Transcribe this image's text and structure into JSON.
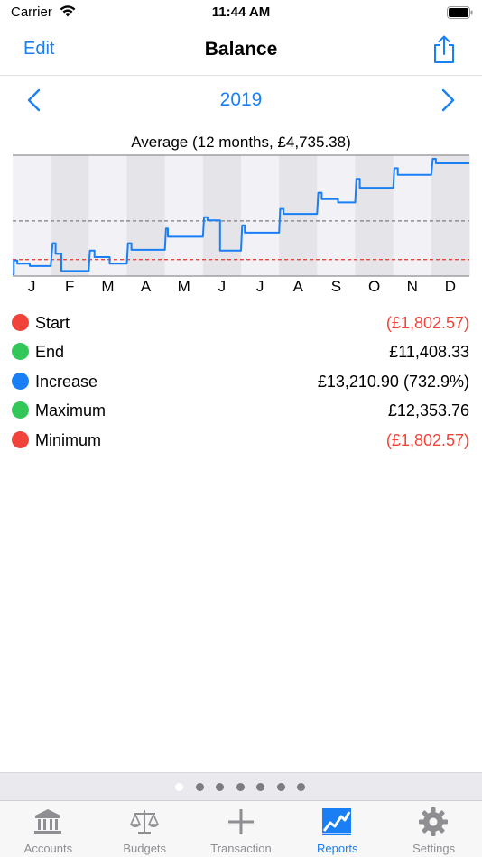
{
  "status": {
    "carrier": "Carrier",
    "time": "11:44 AM"
  },
  "nav": {
    "edit_label": "Edit",
    "title": "Balance"
  },
  "year": {
    "label": "2019"
  },
  "colors": {
    "accent": "#1a7ff5",
    "negative": "#f0443a",
    "positive": "#33c759",
    "line": "#1a7ff5",
    "avg_line": "#8e8e93",
    "zero_line": "#f0443a"
  },
  "chart_data": {
    "type": "line",
    "title": "Average (12 months, £4,735.38)",
    "categories": [
      "J",
      "F",
      "M",
      "A",
      "M",
      "J",
      "J",
      "A",
      "S",
      "O",
      "N",
      "D"
    ],
    "x_unit": "month",
    "average": 4735.38,
    "zero": 0,
    "ylim": [
      -1802.57,
      12353.76
    ],
    "grid": "alternating month bands",
    "series": [
      {
        "points": [
          [
            0.0,
            -1802.57
          ],
          [
            0.03,
            -1802.57
          ],
          [
            0.03,
            -100
          ],
          [
            0.12,
            -100
          ],
          [
            0.12,
            -500
          ],
          [
            0.45,
            -500
          ],
          [
            0.45,
            -800
          ],
          [
            1.0,
            -800
          ],
          [
            1.05,
            2000
          ],
          [
            1.13,
            2000
          ],
          [
            1.13,
            700
          ],
          [
            1.28,
            700
          ],
          [
            1.28,
            -1400
          ],
          [
            2.0,
            -1400
          ],
          [
            2.03,
            1100
          ],
          [
            2.15,
            1100
          ],
          [
            2.15,
            300
          ],
          [
            2.55,
            300
          ],
          [
            2.55,
            -500
          ],
          [
            3.0,
            -500
          ],
          [
            3.03,
            2000
          ],
          [
            3.12,
            2000
          ],
          [
            3.12,
            1200
          ],
          [
            4.0,
            1200
          ],
          [
            4.03,
            3800
          ],
          [
            4.08,
            3800
          ],
          [
            4.08,
            2800
          ],
          [
            5.0,
            2800
          ],
          [
            5.03,
            5200
          ],
          [
            5.12,
            5200
          ],
          [
            5.12,
            4800
          ],
          [
            5.45,
            4800
          ],
          [
            5.45,
            1100
          ],
          [
            6.0,
            1100
          ],
          [
            6.03,
            4200
          ],
          [
            6.1,
            4200
          ],
          [
            6.1,
            3300
          ],
          [
            7.0,
            3300
          ],
          [
            7.03,
            6200
          ],
          [
            7.12,
            6200
          ],
          [
            7.12,
            5600
          ],
          [
            8.0,
            5600
          ],
          [
            8.03,
            8200
          ],
          [
            8.12,
            8200
          ],
          [
            8.12,
            7400
          ],
          [
            8.55,
            7400
          ],
          [
            8.55,
            7000
          ],
          [
            9.0,
            7000
          ],
          [
            9.03,
            9900
          ],
          [
            9.12,
            9900
          ],
          [
            9.12,
            8800
          ],
          [
            10.0,
            8800
          ],
          [
            10.03,
            11200
          ],
          [
            10.12,
            11200
          ],
          [
            10.12,
            10400
          ],
          [
            11.0,
            10400
          ],
          [
            11.04,
            12353.76
          ],
          [
            11.12,
            12353.76
          ],
          [
            11.12,
            11800
          ],
          [
            12.0,
            11800
          ]
        ]
      }
    ]
  },
  "legend": [
    {
      "label": "Start",
      "value": "(£1,802.57)",
      "dot_color": "#f0443a",
      "value_color": "#f0443a"
    },
    {
      "label": "End",
      "value": "£11,408.33",
      "dot_color": "#33c759",
      "value_color": "#000000"
    },
    {
      "label": "Increase",
      "value": "£13,210.90 (732.9%)",
      "dot_color": "#1a7ff5",
      "value_color": "#000000"
    },
    {
      "label": "Maximum",
      "value": "£12,353.76",
      "dot_color": "#33c759",
      "value_color": "#000000"
    },
    {
      "label": "Minimum",
      "value": "(£1,802.57)",
      "dot_color": "#f0443a",
      "value_color": "#f0443a"
    }
  ],
  "pager": {
    "count": 7,
    "active": 0
  },
  "tabs": [
    {
      "label": "Accounts",
      "icon": "bank-icon"
    },
    {
      "label": "Budgets",
      "icon": "scales-icon"
    },
    {
      "label": "Transaction",
      "icon": "plus-icon"
    },
    {
      "label": "Reports",
      "icon": "chart-icon",
      "active": true
    },
    {
      "label": "Settings",
      "icon": "gear-icon"
    }
  ]
}
